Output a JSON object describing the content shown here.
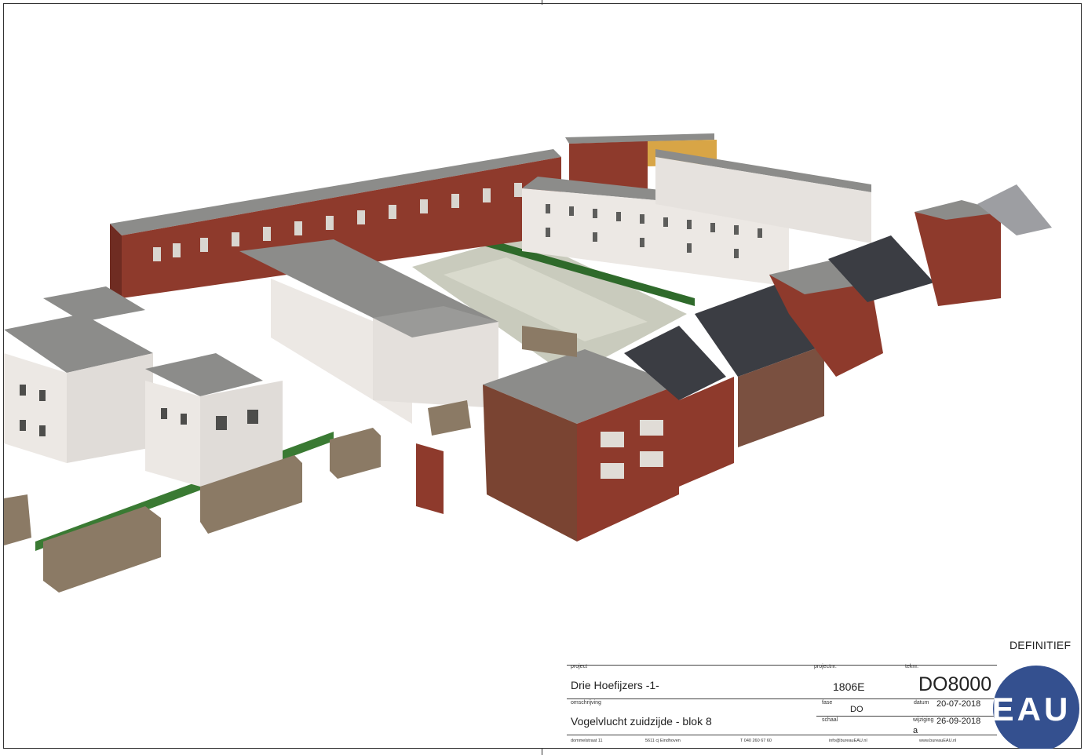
{
  "status": "DEFINITIEF",
  "titleblock": {
    "project_label": "project",
    "project_value": "Drie Hoefijzers -1-",
    "projectnr_label": "projectnr.",
    "projectnr_value": "1806E",
    "teknr_label": "teknr.",
    "teknr_value": "DO8000",
    "omschrijving_label": "omschrijving",
    "omschrijving_value": "Vogelvlucht zuidzijde - blok 8",
    "fase_label": "fase",
    "fase_value": "DO",
    "schaal_label": "schaal",
    "schaal_value": "",
    "datum_label": "datum",
    "datum_value": "20-07-2018",
    "wijziging_label": "wijziging",
    "wijziging_date": "26-09-2018",
    "wijziging_letter": "a",
    "footer": {
      "address": "dommelstraat 11",
      "city": "5611 cj Eindhoven",
      "phone": "T 040 260 67 60",
      "email": "info@bureauEAU.nl",
      "web": "www.bureauEAU.nl"
    }
  },
  "logo": {
    "text": "EAU",
    "color": "#34508f"
  },
  "colors": {
    "brick_red": "#8e3a2c",
    "brick_brown": "#7a4432",
    "white_facade": "#ece8e4",
    "roof_grey": "#8c8c8a",
    "courtyard": "#c9cbbd",
    "hedge": "#2f6a2b",
    "pitched_roof": "#3b3d43"
  }
}
